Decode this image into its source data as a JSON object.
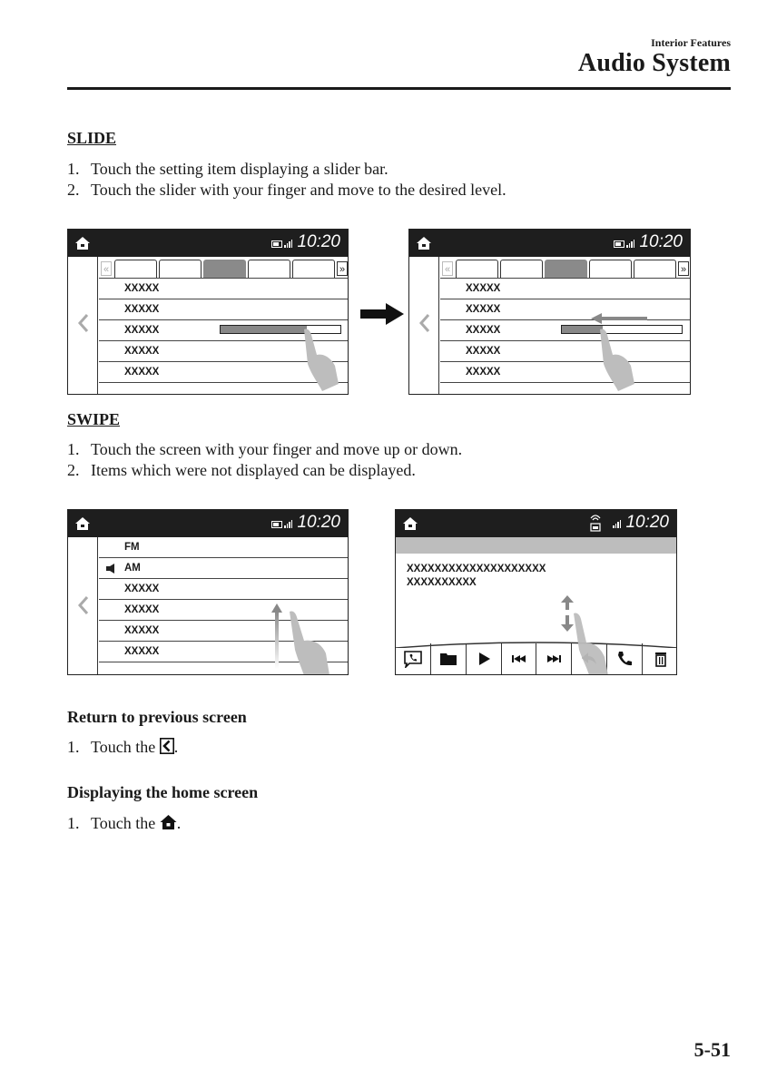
{
  "header": {
    "section": "Interior Features",
    "title": "Audio System"
  },
  "slide": {
    "heading": "SLIDE",
    "steps": [
      {
        "num": "1.",
        "text": "Touch the setting item displaying a slider bar."
      },
      {
        "num": "2.",
        "text": "Touch the slider with your finger and move to the desired level."
      }
    ],
    "screens": [
      {
        "time": "10:20",
        "rows": [
          "XXXXX",
          "XXXXX",
          "XXXXX",
          "XXXXX",
          "XXXXX"
        ],
        "selected_tab": 3,
        "slider_level": 0.72
      },
      {
        "time": "10:20",
        "rows": [
          "XXXXX",
          "XXXXX",
          "XXXXX",
          "XXXXX",
          "XXXXX"
        ],
        "selected_tab": 3,
        "slider_level": 0.34
      }
    ]
  },
  "swipe": {
    "heading": "SWIPE",
    "steps": [
      {
        "num": "1.",
        "text": "Touch the screen with your finger and move up or down."
      },
      {
        "num": "2.",
        "text": "Items which were not displayed can be displayed."
      }
    ],
    "screens": [
      {
        "time": "10:20",
        "rows": [
          "FM",
          "AM",
          "XXXXX",
          "XXXXX",
          "XXXXX",
          "XXXXX"
        ]
      },
      {
        "time": "10:20",
        "message_lines": [
          "XXXXXXXXXXXXXXXXXXXX",
          "XXXXXXXXXX"
        ],
        "toolbar": [
          "message-reply-icon",
          "folder-icon",
          "play-icon",
          "previous-track-icon",
          "next-track-icon",
          "reply-icon",
          "call-icon",
          "delete-icon"
        ]
      }
    ]
  },
  "return_section": {
    "heading": "Return to previous screen",
    "step_num": "1.",
    "step_prefix": "Touch the",
    "step_suffix": "."
  },
  "home_section": {
    "heading": "Displaying the home screen",
    "step_num": "1.",
    "step_prefix": "Touch the",
    "step_suffix": "."
  },
  "page_number": "5-51"
}
